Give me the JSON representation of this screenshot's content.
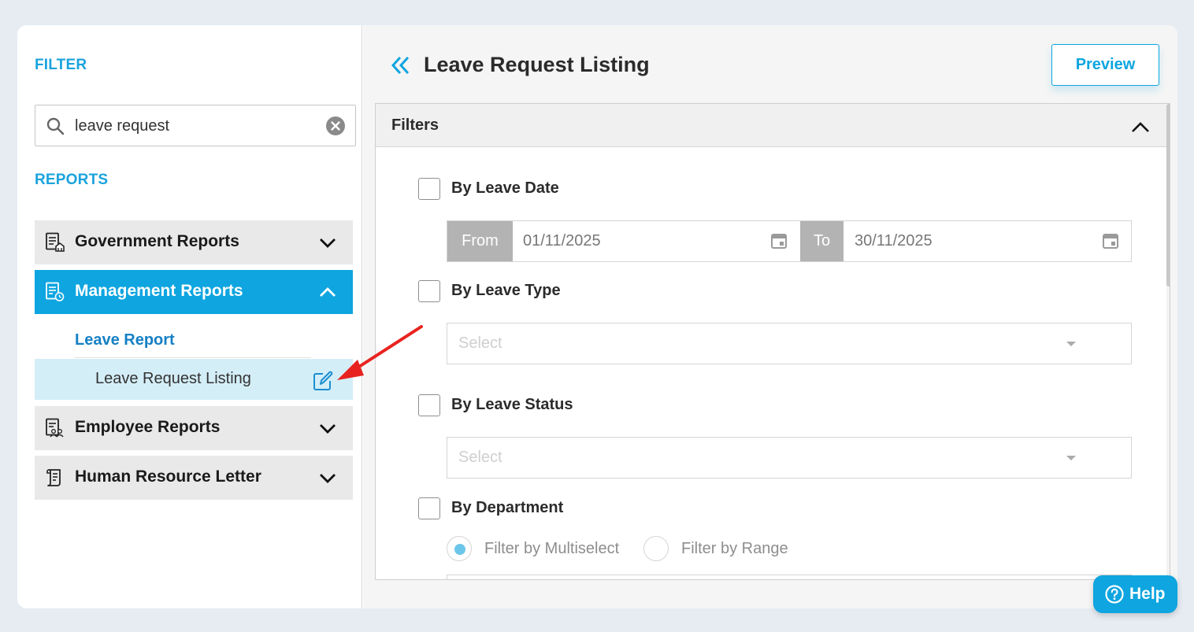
{
  "sidebar": {
    "filter_label": "FILTER",
    "search": {
      "value": "leave request"
    },
    "reports_label": "REPORTS",
    "categories": [
      {
        "label": "Government Reports",
        "icon": "government-report-icon",
        "expanded": false
      },
      {
        "label": "Management Reports",
        "icon": "management-report-icon",
        "expanded": true
      },
      {
        "label": "Employee Reports",
        "icon": "employee-report-icon",
        "expanded": false
      },
      {
        "label": "Human Resource Letter",
        "icon": "hr-letter-icon",
        "expanded": false
      }
    ],
    "subgroup": {
      "label": "Leave Report",
      "items": [
        {
          "label": "Leave Request Listing",
          "selected": true
        }
      ]
    }
  },
  "main": {
    "title": "Leave Request Listing",
    "preview_label": "Preview",
    "filters_title": "Filters",
    "by_leave_date": "By Leave Date",
    "from_label": "From",
    "from_value": "01/11/2025",
    "to_label": "To",
    "to_value": "30/11/2025",
    "by_leave_type": "By Leave Type",
    "leave_type_placeholder": "Select",
    "by_leave_status": "By Leave Status",
    "leave_status_placeholder": "Select",
    "by_department": "By Department",
    "radio_multiselect": "Filter by Multiselect",
    "radio_range": "Filter by Range",
    "selected_radio": "Filter by Multiselect"
  },
  "help_label": "Help",
  "colors": {
    "accent": "#0ea5e0",
    "selected_row": "#d4eef8",
    "annotation_arrow": "#e8231f"
  }
}
